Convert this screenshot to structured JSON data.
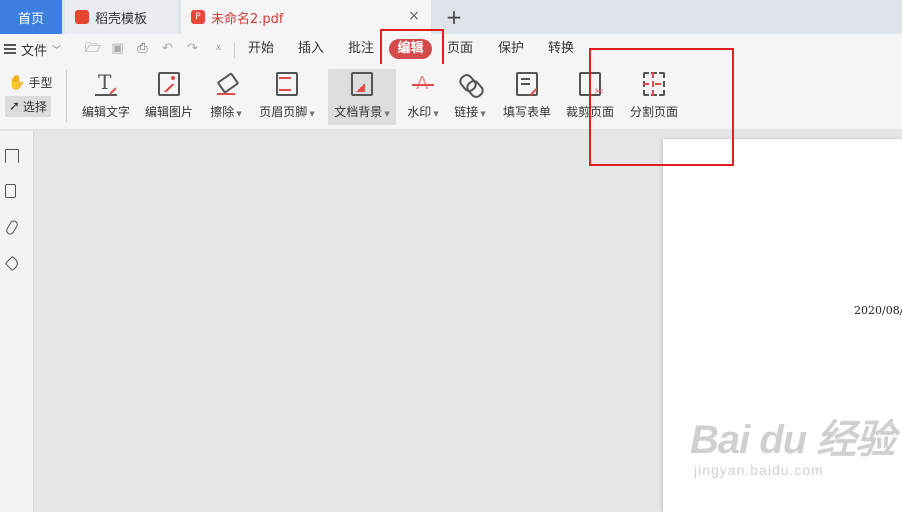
{
  "tabs": {
    "home": "首页",
    "template": "稻壳模板",
    "doc": "未命名2.pdf",
    "close": "×",
    "add": "+"
  },
  "menu": {
    "file": "文件",
    "items": [
      "开始",
      "插入",
      "批注",
      "编辑",
      "页面",
      "保护",
      "转换"
    ],
    "active": "编辑"
  },
  "modes": {
    "hand": "手型",
    "select": "选择"
  },
  "tools": [
    {
      "label": "编辑文字",
      "icon": "edit-text-icon"
    },
    {
      "label": "编辑图片",
      "icon": "edit-image-icon"
    },
    {
      "label": "擦除",
      "icon": "eraser-icon",
      "dropdown": true
    },
    {
      "label": "页眉页脚",
      "icon": "header-footer-icon",
      "dropdown": true
    },
    {
      "label": "文档背景",
      "icon": "document-background-icon",
      "dropdown": true,
      "active": true
    },
    {
      "label": "水印",
      "icon": "watermark-icon",
      "dropdown": true
    },
    {
      "label": "链接",
      "icon": "link-icon",
      "dropdown": true
    },
    {
      "label": "填写表单",
      "icon": "fill-form-icon"
    },
    {
      "label": "裁剪页面",
      "icon": "crop-page-icon"
    },
    {
      "label": "分割页面",
      "icon": "split-page-icon"
    }
  ],
  "document": {
    "date_text": "2020/08/"
  },
  "watermark": {
    "logo": "Bai du 经验",
    "url": "jingyan.baidu.com"
  },
  "colors": {
    "accent_tab": "#3d7fe0",
    "active_menu": "#d44a4a",
    "annotation": "#e02020"
  }
}
